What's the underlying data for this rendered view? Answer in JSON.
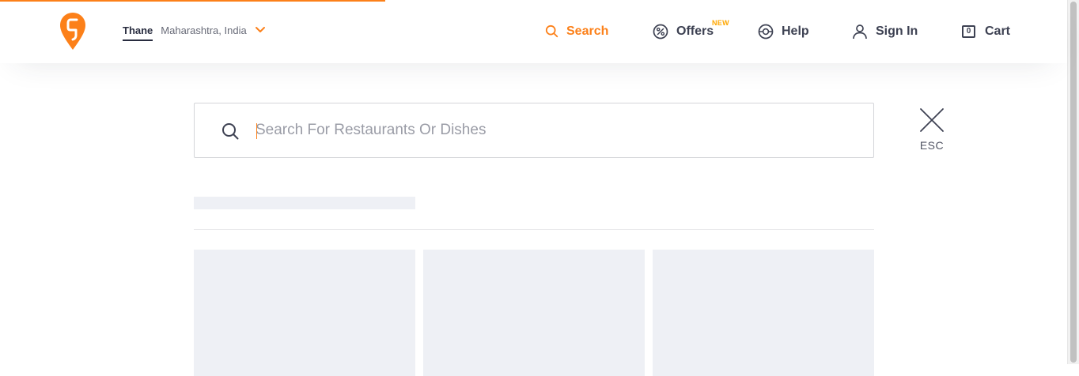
{
  "header": {
    "location": {
      "city": "Thane",
      "region": "Maharashtra, India"
    },
    "nav": {
      "search": "Search",
      "offers": "Offers",
      "offers_badge": "NEW",
      "help": "Help",
      "sign_in": "Sign In",
      "cart": "Cart",
      "cart_count": "0"
    }
  },
  "search": {
    "placeholder": "Search For Restaurants Or Dishes",
    "value": ""
  },
  "close": {
    "label": "ESC"
  },
  "loading": {
    "state": "skeleton placeholders",
    "card_count": 3
  },
  "colors": {
    "brand": "#fc8019",
    "badge": "#ffa700",
    "text": "#3d4152",
    "skeleton": "#eef0f5"
  },
  "icons": [
    "swiggy-logo-icon",
    "chevron-down-icon",
    "search-icon",
    "offers-icon",
    "help-icon",
    "user-icon",
    "cart-icon",
    "close-icon"
  ]
}
